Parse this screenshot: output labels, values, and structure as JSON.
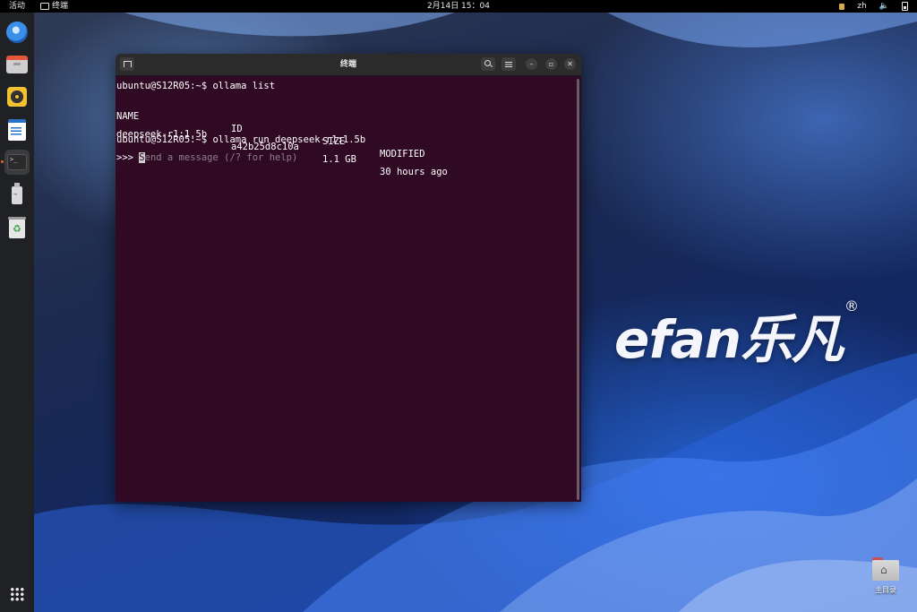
{
  "topbar": {
    "activities": "活动",
    "app_name": "终端",
    "clock": "2月14日 15：04",
    "input_method": "zh"
  },
  "desktop": {
    "brand_text": "efan乐凡",
    "brand_mark": "®",
    "home_folder_label": "主目录"
  },
  "dock": {
    "items": [
      "thunderbird-icon",
      "files-icon",
      "rhythmbox-icon",
      "writer-icon",
      "terminal-icon",
      "usb-drive-icon",
      "trash-icon",
      "app-grid-icon"
    ],
    "terminal_glyph": ">_"
  },
  "terminal": {
    "title": "终端",
    "prompt": "ubuntu@S12R05:~$",
    "cmd1": "ollama list",
    "table": {
      "headers": [
        "NAME",
        "ID",
        "SIZE",
        "MODIFIED"
      ],
      "rows": [
        [
          "deepseek-r1:1.5b",
          "a42b25d8c10a",
          "1.1 GB",
          "30 hours ago"
        ]
      ]
    },
    "cmd2": "ollama run deepseek-r1:1.5b",
    "repl_prompt": ">>>",
    "cursor_char": "S",
    "placeholder_rest": "end a message (/? for help)"
  },
  "colors": {
    "terminal_bg": "#300a24",
    "header_bg": "#2b2b2b",
    "dock_bg": "#202124"
  }
}
